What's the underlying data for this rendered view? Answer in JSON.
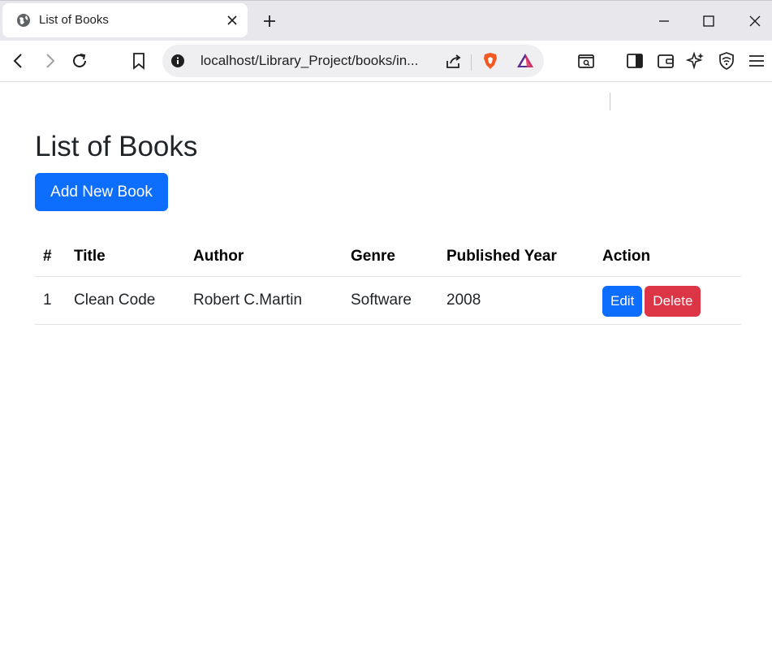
{
  "browser": {
    "tab_title": "List of Books",
    "url": "localhost/Library_Project/books/in...",
    "colors": {
      "tabstrip": "#e8e8ec",
      "toolbar": "#ffffff",
      "omnibox": "#efeff2"
    }
  },
  "page": {
    "title": "List of Books",
    "add_button": "Add New Book",
    "table": {
      "headers": [
        "#",
        "Title",
        "Author",
        "Genre",
        "Published Year",
        "Action"
      ],
      "rows": [
        {
          "id": "1",
          "title": "Clean Code",
          "author": "Robert C.Martin",
          "genre": "Software",
          "year": "2008",
          "edit_label": "Edit",
          "delete_label": "Delete"
        }
      ]
    },
    "colors": {
      "primary": "#0d6efd",
      "danger": "#dc3545",
      "text": "#212529"
    }
  }
}
